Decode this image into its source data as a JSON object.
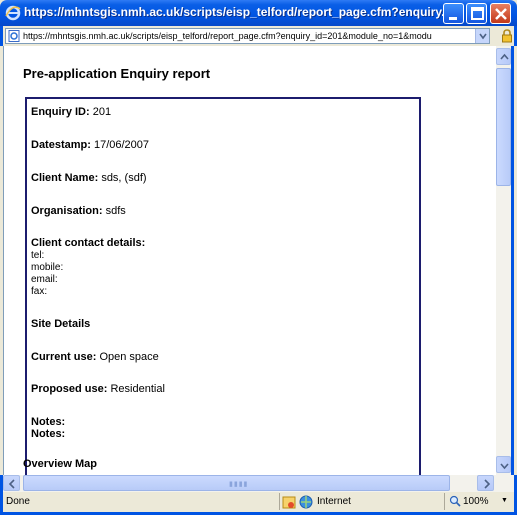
{
  "window": {
    "title": "https://mhntsgis.nmh.ac.uk/scripts/eisp_telford/report_page.cfm?enquiry...",
    "minimize_icon": "minimize-icon",
    "maximize_icon": "maximize-icon",
    "close_icon": "close-icon"
  },
  "address_bar": {
    "url": "https://mhntsgis.nmh.ac.uk/scripts/eisp_telford/report_page.cfm?enquiry_id=201&module_no=1&modu"
  },
  "page": {
    "title": "Pre-application Enquiry report",
    "enquiry_id_label": "Enquiry ID:",
    "enquiry_id_value": "201",
    "datestamp_label": "Datestamp:",
    "datestamp_value": "17/06/2007",
    "client_name_label": "Client Name:",
    "client_name_value": "sds, (sdf)",
    "organisation_label": "Organisation:",
    "organisation_value": "sdfs",
    "contact_label": "Client contact details:",
    "contact_lines": [
      "tel:",
      "mobile:",
      "email:",
      "fax:"
    ],
    "site_details_label": "Site Details",
    "current_use_label": "Current use:",
    "current_use_value": "Open space",
    "proposed_use_label": "Proposed use:",
    "proposed_use_value": "Residential",
    "notes_label_1": "Notes:",
    "notes_label_2": "Notes:",
    "overview_map_label": "Overview Map"
  },
  "status_bar": {
    "status": "Done",
    "zone": "Internet",
    "zoom": "100%"
  },
  "colors": {
    "titlebar": "#0054e3",
    "report_border": "#1c1c6e",
    "chrome": "#ece9d8"
  }
}
